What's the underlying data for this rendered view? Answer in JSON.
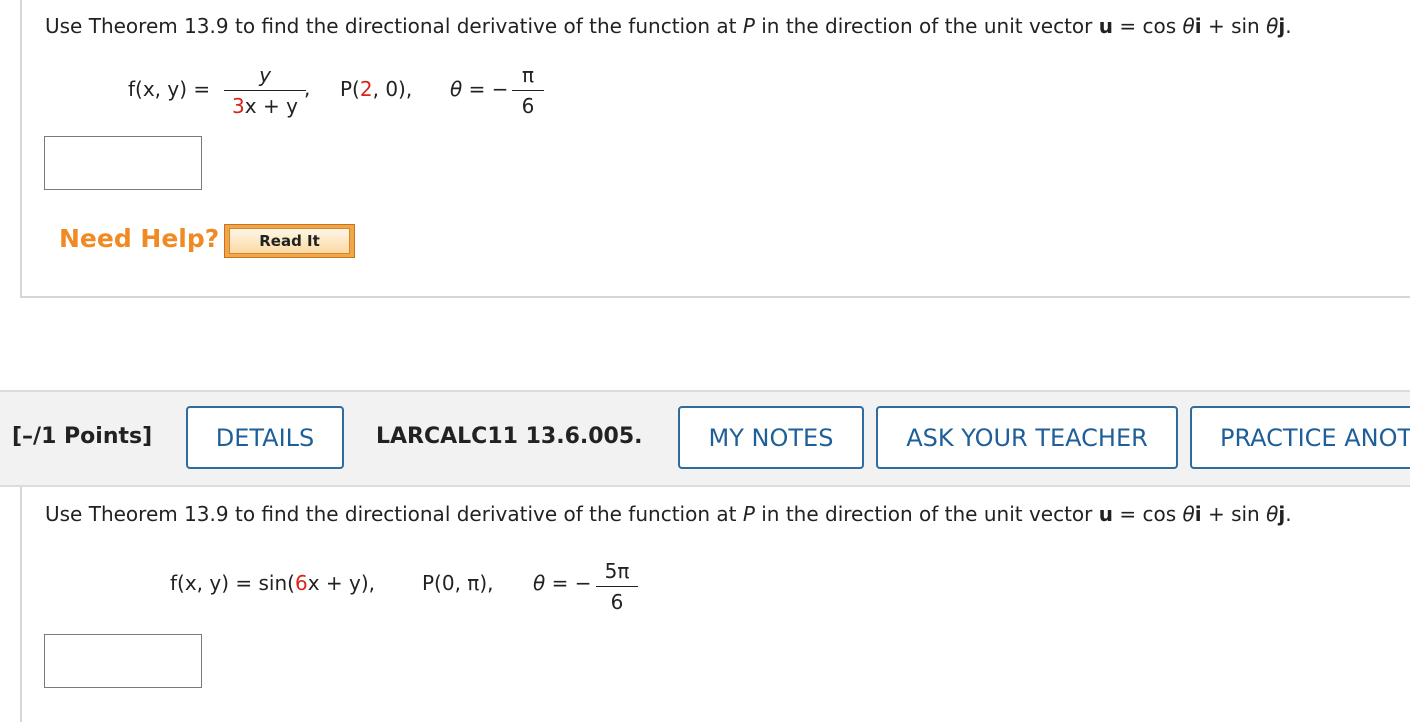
{
  "q1": {
    "prompt": {
      "pre": "Use Theorem 13.9 to find the directional derivative of the function at ",
      "P": "P",
      "mid": " in the direction of the unit vector ",
      "u": "u",
      "eq": " = cos ",
      "theta1": "θ",
      "i": "i",
      "plus": " + sin ",
      "theta2": "θ",
      "j": "j",
      "end": "."
    },
    "f_lhs": "f(x, y) =",
    "frac_num": "y",
    "frac_den_a": "3",
    "frac_den_b": "x + y",
    "comma": ",",
    "point_pre": "P(",
    "point_red": "2",
    "point_post": ", 0),",
    "theta_eq": "θ = −",
    "theta_num": "π",
    "theta_den": "6"
  },
  "need_help": "Need Help?",
  "read_it": "Read It",
  "toolbar": {
    "points": "[–/1 Points]",
    "details": "DETAILS",
    "code": "LARCALC11 13.6.005.",
    "my_notes": "MY NOTES",
    "ask_teacher": "ASK YOUR TEACHER",
    "practice": "PRACTICE ANOTHER"
  },
  "q2": {
    "prompt": {
      "pre": "Use Theorem 13.9 to find the directional derivative of the function at ",
      "P": "P",
      "mid": " in the direction of the unit vector ",
      "u": "u",
      "eq": " = cos ",
      "theta1": "θ",
      "i": "i",
      "plus": " + sin ",
      "theta2": "θ",
      "j": "j",
      "end": "."
    },
    "f_pre": "f(x, y) = sin(",
    "f_red": "6",
    "f_post": "x + y),",
    "point": "P(0, π),",
    "theta_eq": "θ = −",
    "theta_num": "5π",
    "theta_den": "6"
  }
}
